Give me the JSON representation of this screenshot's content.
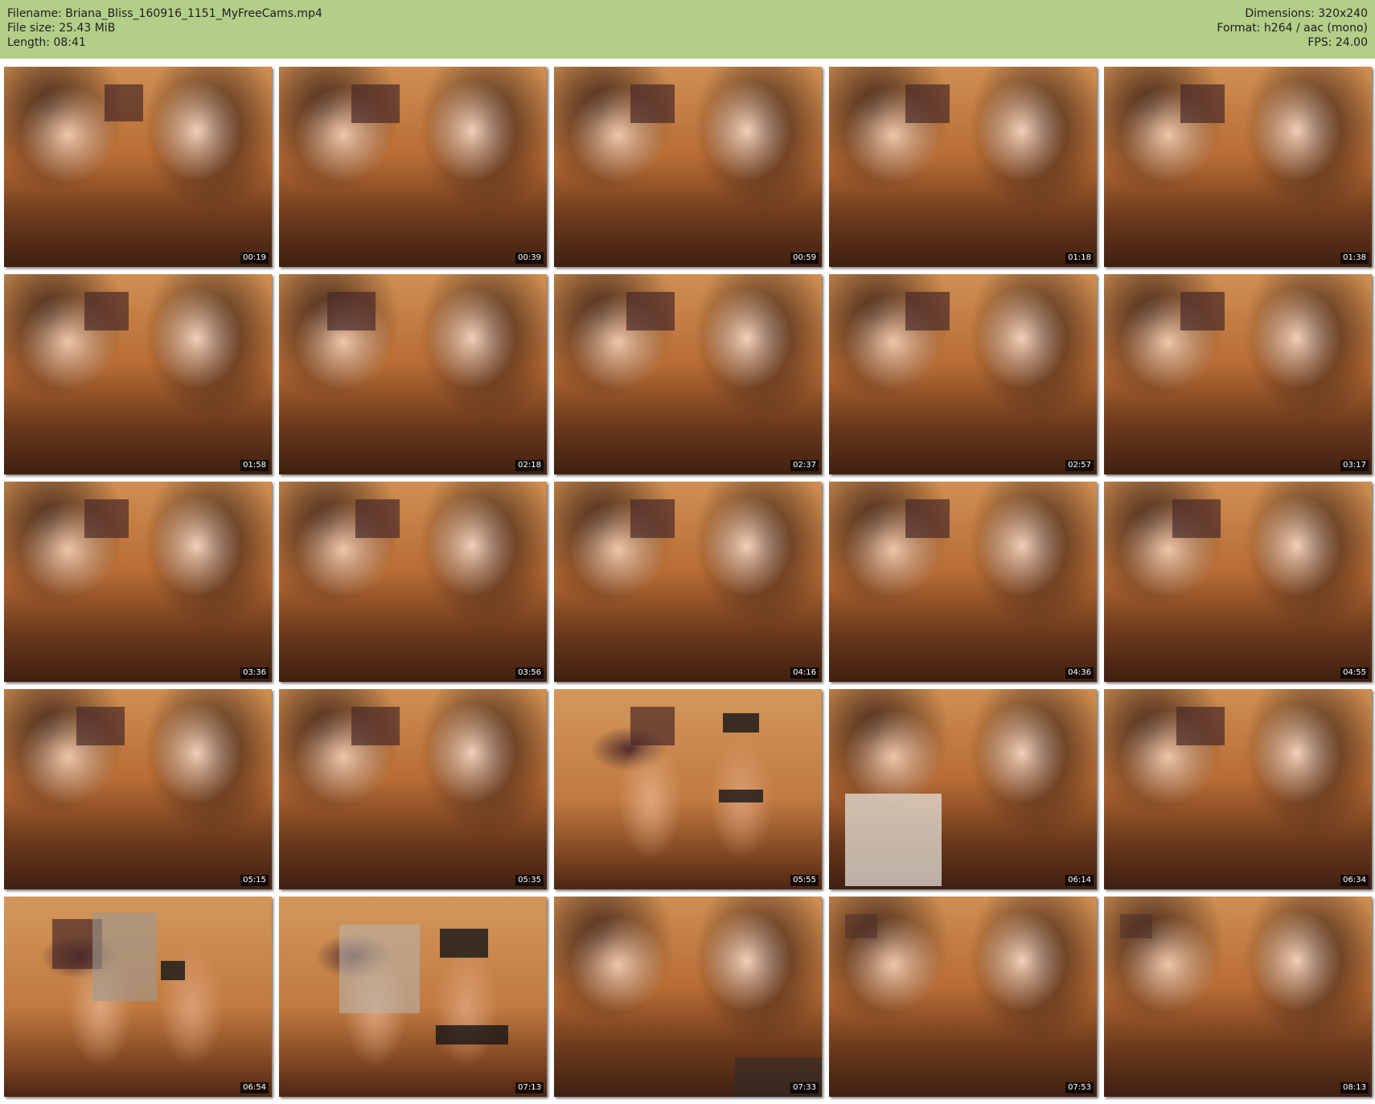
{
  "header": {
    "filename": "Filename: Briana_Bliss_160916_1151_MyFreeCams.mp4",
    "file_size": "File size: 25.43 MiB",
    "length": "Length: 08:41",
    "dimensions": "Dimensions: 320x240",
    "format": "Format: h264 / aac (mono)",
    "fps": "FPS: 24.00"
  },
  "timestamps": [
    "00:19",
    "00:39",
    "00:59",
    "01:18",
    "01:38",
    "01:58",
    "02:18",
    "02:37",
    "02:57",
    "03:17",
    "03:36",
    "03:56",
    "04:16",
    "04:36",
    "04:55",
    "05:15",
    "05:35",
    "05:55",
    "06:14",
    "06:34",
    "06:54",
    "07:13",
    "07:33",
    "07:53",
    "08:13"
  ],
  "colors": {
    "header_bg": "#b3ce88",
    "timestamp_bg": "#000000",
    "timestamp_text": "#ffffff"
  }
}
